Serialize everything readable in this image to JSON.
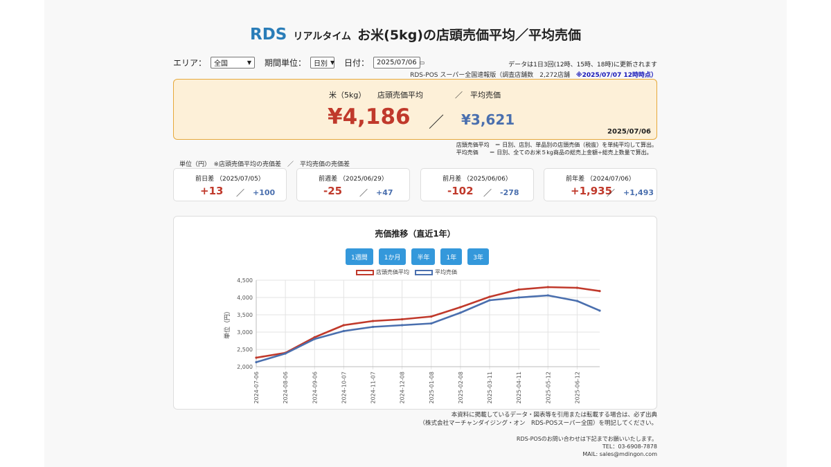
{
  "header": {
    "logo": "RDS",
    "subtitle": "リアルタイム",
    "title": "お米(5kg)の店頭売価平均／平均売価"
  },
  "controls": {
    "area_label": "エリア：",
    "area_value": "全国",
    "period_label": "期間単位：",
    "period_value": "日別",
    "date_label": "日付：",
    "date_value": "2025/07/06"
  },
  "notes": {
    "update": "データは1日3回(12時、15時、18時)に更新されます",
    "source": "RDS-POS スーパー全国速報版（調査店舗数　2,272店舗",
    "source_time": "※2025/07/07 12時時点）"
  },
  "hero": {
    "label1": "米（5kg）",
    "label2": "店頭売価平均",
    "label_sep": "／",
    "label3": "平均売価",
    "price1": "¥4,186",
    "sep": "／",
    "price2": "¥3,621",
    "date": "2025/07/06"
  },
  "definitions": {
    "line1": "店頭売価平均　＝ 日別、店別、単品別の店頭売価（税抜）を単純平均して算出。",
    "line2": "平均売価　　＝ 日別、全てのお米５kg商品の総売上金額÷総売上数量で算出。"
  },
  "unit_line": "単位（円）　※店頭売価平均の売価差　／　平均売価の売価差",
  "diffs": [
    {
      "label": "前日差 （2025/07/05）",
      "v1": "+13",
      "sep": "／",
      "v2": "+100"
    },
    {
      "label": "前週差 （2025/06/29）",
      "v1": "-25",
      "sep": "／",
      "v2": "+47"
    },
    {
      "label": "前月差 （2025/06/06）",
      "v1": "-102",
      "sep": "／",
      "v2": "-278"
    },
    {
      "label": "前年差 （2024/07/06）",
      "v1": "+1,935",
      "sep": "／",
      "v2": "+1,493"
    }
  ],
  "chart_section": {
    "title": "売価推移（直近1年）",
    "buttons": [
      "1週間",
      "1か月",
      "半年",
      "1年",
      "3年"
    ]
  },
  "chart_data": {
    "type": "line",
    "ylabel": "単位（円）",
    "xlabel": "",
    "ylim": [
      2000,
      4500
    ],
    "yticks": [
      "4,500",
      "4,000",
      "3,500",
      "3,000",
      "2,500",
      "2,000"
    ],
    "x_tick_labels": [
      "2024-07-06",
      "2024-08-06",
      "2024-09-06",
      "2024-10-07",
      "2024-11-07",
      "2024-12-08",
      "2025-01-08",
      "2025-02-08",
      "2025-03-11",
      "2025-04-11",
      "2025-05-12",
      "2025-06-12"
    ],
    "x": [
      "2024-07-06",
      "2024-08-06",
      "2024-09-06",
      "2024-10-07",
      "2024-11-07",
      "2024-12-08",
      "2025-01-08",
      "2025-02-08",
      "2025-03-11",
      "2025-04-11",
      "2025-05-12",
      "2025-06-12",
      "2025-07-06"
    ],
    "series": [
      {
        "name": "店頭売価平均",
        "color": "#c0392b",
        "values": [
          2260,
          2400,
          2850,
          3200,
          3320,
          3370,
          3450,
          3720,
          4020,
          4230,
          4300,
          4280,
          4186
        ]
      },
      {
        "name": "平均売価",
        "color": "#4a6fae",
        "values": [
          2130,
          2380,
          2800,
          3030,
          3150,
          3200,
          3250,
          3560,
          3920,
          4000,
          4060,
          3900,
          3621
        ]
      }
    ],
    "grid": true,
    "legend": "top-center"
  },
  "footer": {
    "copy1": "本資料に掲載しているデータ・図表等を引用または転載する場合は、必ず出典",
    "copy2": "（株式会社マーチャンダイジング・オン　RDS-POSスーパー全国）を明記してください。",
    "contact1": "RDS-POSのお問い合わせは下記までお願いいたします。",
    "contact2": "TEL：03-6908-7878",
    "contact3": "MAIL: sales@mdingon.com"
  }
}
